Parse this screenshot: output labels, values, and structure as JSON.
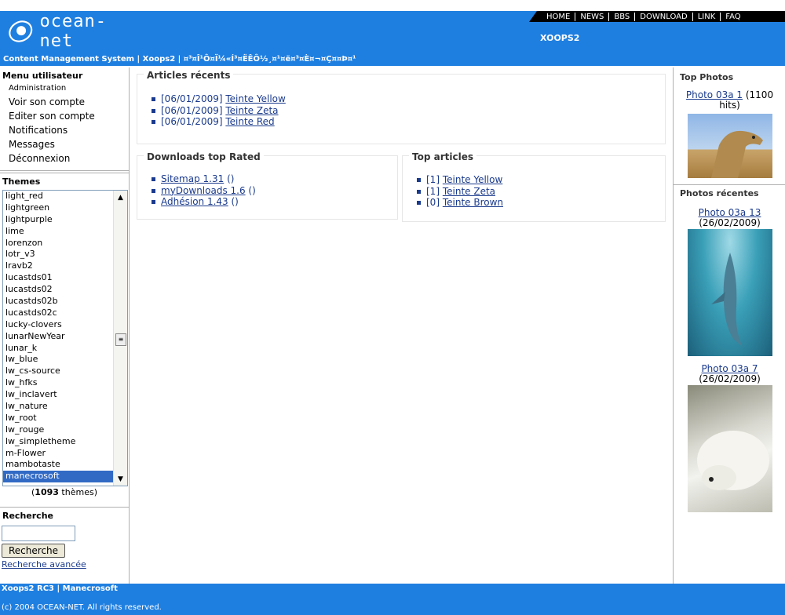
{
  "header": {
    "logo_text": "ocean-net",
    "site_name": "XOOPS2",
    "slogan": "Content Management System | Xoops2 | ¤³¤Î¹Ô¤Ï¼«Í³¤ËÊÔ½¸¤¹¤ë¤³¤È¤¬¤Ç¤­¤Þ¤¹",
    "nav": [
      "HOME",
      "NEWS",
      "BBS",
      "DOWNLOAD",
      "LINK",
      "FAQ"
    ],
    "colors": {
      "primary": "#1f7fe0",
      "nav_bg": "#000000"
    }
  },
  "user_menu": {
    "title": "Menu utilisateur",
    "items": [
      "Administration",
      "Voir son compte",
      "Editer son compte",
      "Notifications",
      "Messages",
      "Déconnexion"
    ]
  },
  "themes": {
    "title": "Themes",
    "items": [
      "light_red",
      "lightgreen",
      "lightpurple",
      "lime",
      "lorenzon",
      "lotr_v3",
      "lravb2",
      "lucastds01",
      "lucastds02",
      "lucastds02b",
      "lucastds02c",
      "lucky-clovers",
      "lunarNewYear",
      "lunar_k",
      "lw_blue",
      "lw_cs-source",
      "lw_hfks",
      "lw_inclavert",
      "lw_nature",
      "lw_root",
      "lw_rouge",
      "lw_simpletheme",
      "m-Flower",
      "mambotaste",
      "manecrosoft"
    ],
    "selected": "manecrosoft",
    "count_number": "1093",
    "count_suffix": "thèmes"
  },
  "search": {
    "title": "Recherche",
    "value": "",
    "button_label": "Recherche",
    "advanced_link": "Recherche avancée"
  },
  "recent_articles": {
    "title": "Articles récents",
    "items": [
      {
        "date": "[06/01/2009]",
        "title": "Teinte Yellow"
      },
      {
        "date": "[06/01/2009]",
        "title": "Teinte Zeta"
      },
      {
        "date": "[06/01/2009]",
        "title": "Teinte Red"
      }
    ]
  },
  "downloads": {
    "title": "Downloads top Rated",
    "items": [
      {
        "name": "Sitemap 1.31",
        "suffix": "()"
      },
      {
        "name": "myDownloads 1.6",
        "suffix": "()"
      },
      {
        "name": "Adhésion 1.43",
        "suffix": "()"
      }
    ]
  },
  "top_articles": {
    "title": "Top articles",
    "items": [
      {
        "count": "[1]",
        "title": "Teinte Yellow"
      },
      {
        "count": "[1]",
        "title": "Teinte Zeta"
      },
      {
        "count": "[0]",
        "title": "Teinte Brown"
      }
    ]
  },
  "top_photos": {
    "title": "Top Photos",
    "link": "Photo 03a 1",
    "hits": "(1100 hits)"
  },
  "recent_photos": {
    "title": "Photos récentes",
    "items": [
      {
        "link": "Photo 03a 13",
        "date": "(26/02/2009)"
      },
      {
        "link": "Photo 03a 7",
        "date": "(26/02/2009)"
      }
    ]
  },
  "footer": {
    "line1": "Xoops2 RC3 | Manecrosoft",
    "copyright": "(c) 2004 OCEAN-NET. All rights reserved."
  }
}
